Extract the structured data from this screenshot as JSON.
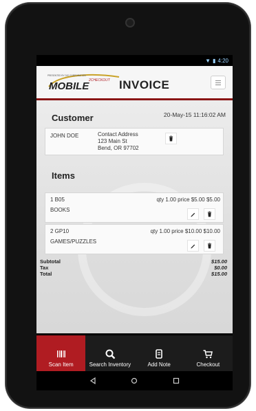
{
  "status": {
    "time": "4:20"
  },
  "appbar": {
    "logo_main": "MOBILE",
    "logo_sup": "2CHECKOUT",
    "logo_tagline": "PRESENTED BY DIG CORPORATION",
    "title": "INVOICE"
  },
  "customer": {
    "heading": "Customer",
    "date": "20-May-15 11:16:02 AM",
    "name": "JOHN DOE",
    "address_lines": [
      "Contact Address",
      "123 Main St",
      "Bend, OR 97702"
    ]
  },
  "items": {
    "heading": "Items",
    "rows": [
      {
        "code": "1 B05",
        "name": "BOOKS",
        "line": "qty 1.00 price $5.00 $5.00"
      },
      {
        "code": "2 GP10",
        "name": "GAMES/PUZZLES",
        "line": "qty 1.00 price $10.00 $10.00"
      }
    ]
  },
  "totals": {
    "subtotal_label": "Subtotal",
    "subtotal": "$15.00",
    "tax_label": "Tax",
    "tax": "$0.00",
    "total_label": "Total",
    "total": "$15.00"
  },
  "nav": [
    {
      "label": "Scan Item",
      "icon": "barcode-icon",
      "active": true
    },
    {
      "label": "Search Inventory",
      "icon": "search-icon",
      "active": false
    },
    {
      "label": "Add Note",
      "icon": "note-icon",
      "active": false
    },
    {
      "label": "Checkout",
      "icon": "cart-icon",
      "active": false
    }
  ],
  "colors": {
    "accent": "#b01c22",
    "appbar_rule": "#8a1515",
    "nav_bg": "#1c1c1c"
  }
}
